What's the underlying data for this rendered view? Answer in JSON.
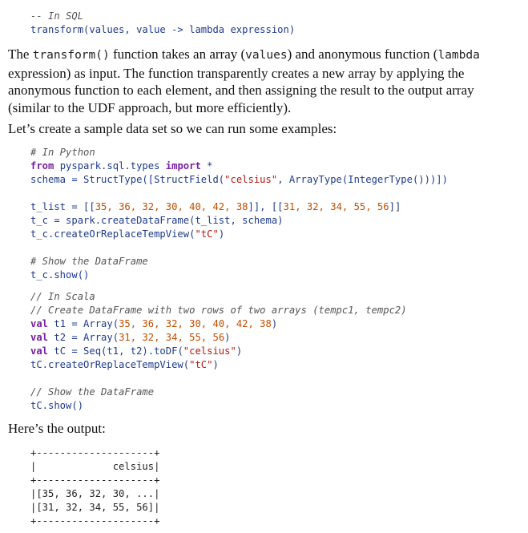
{
  "sql": {
    "comment": "-- In SQL",
    "signature": "transform(values, value -> lambda expression)"
  },
  "para1": {
    "t1": "The ",
    "c1": "transform()",
    "t2": " function takes an array (",
    "c2": "values",
    "t3": ") and anonymous function (",
    "c3": "lambda",
    "t4": " expression) as input. The function transparently creates a new array by applying the anonymous function to each element, and then assigning the result to the output array (similar to the UDF approach, but more efficiently)."
  },
  "para2": "Let’s create a sample data set so we can run some examples:",
  "python": {
    "comment": "# In Python",
    "import_from": "from",
    "import_module": " pyspark.sql.types ",
    "import_kw": "import",
    "import_rest": " *",
    "schema_a": "schema = StructType([StructField(",
    "schema_str": "\"celsius\"",
    "schema_b": ", ArrayType(IntegerType()))])",
    "tlist_a": "t_list = [[",
    "tlist_n1": "35, 36, 32, 30, 40, 42, 38",
    "tlist_b": "]], [[",
    "tlist_n2": "31, 32, 34, 55, 56",
    "tlist_c": "]]",
    "tc_line": "t_c = spark.createDataFrame(t_list, schema)",
    "view_a": "t_c.createOrReplaceTempView(",
    "view_str": "\"tC\"",
    "view_b": ")",
    "show_comment": "# Show the DataFrame",
    "show_line": "t_c.show()"
  },
  "scala": {
    "comment1": "// In Scala",
    "comment2": "// Create DataFrame with two rows of two arrays (tempc1, tempc2)",
    "val": "val",
    "t1_a": " t1 = Array(",
    "t1_n": "35, 36, 32, 30, 40, 42, 38",
    "t1_b": ")",
    "t2_a": " t2 = Array(",
    "t2_n": "31, 32, 34, 55, 56",
    "t2_b": ")",
    "tc_a": " tC = Seq(t1, t2).toDF(",
    "tc_str": "\"celsius\"",
    "tc_b": ")",
    "view_a": "tC.createOrReplaceTempView(",
    "view_str": "\"tC\"",
    "view_b": ")",
    "show_comment": "// Show the DataFrame",
    "show_line": "tC.show()"
  },
  "para3": "Here’s the output:",
  "output": {
    "border1": "+--------------------+",
    "header": "|             celsius|",
    "border2": "+--------------------+",
    "row1": "|[35, 36, 32, 30, ...|",
    "row2": "|[31, 32, 34, 55, 56]|",
    "border3": "+--------------------+"
  }
}
